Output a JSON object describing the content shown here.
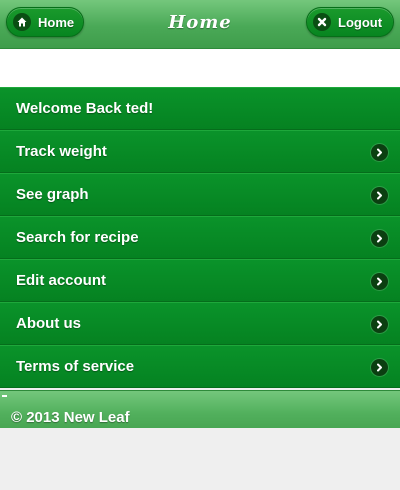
{
  "header": {
    "title": "Home",
    "home_button": {
      "label": "Home",
      "icon": "home-icon"
    },
    "logout_button": {
      "label": "Logout",
      "icon": "close-icon"
    }
  },
  "menu": {
    "welcome": "Welcome Back ted!",
    "items": [
      {
        "label": "Track weight",
        "icon": "chevron-right-icon"
      },
      {
        "label": "See graph",
        "icon": "chevron-right-icon"
      },
      {
        "label": "Search for recipe",
        "icon": "chevron-right-icon"
      },
      {
        "label": "Edit account",
        "icon": "chevron-right-icon"
      },
      {
        "label": "About us",
        "icon": "chevron-right-icon"
      },
      {
        "label": "Terms of service",
        "icon": "chevron-right-icon"
      }
    ]
  },
  "footer": {
    "text": "© 2013 New Leaf"
  },
  "colors": {
    "header_green": "#4aa957",
    "list_green": "#078520",
    "button_green": "#078520",
    "background": "#efefef"
  }
}
